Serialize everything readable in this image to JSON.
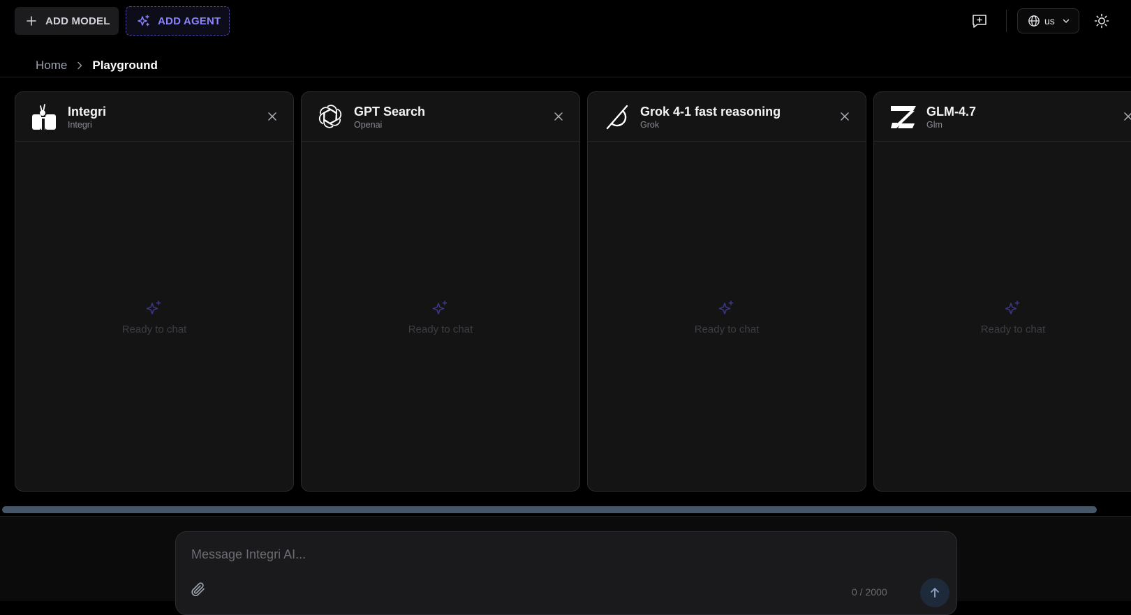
{
  "toolbar": {
    "add_model_label": "ADD MODEL",
    "add_agent_label": "ADD AGENT",
    "language": "us"
  },
  "breadcrumb": {
    "home": "Home",
    "current": "Playground"
  },
  "panels": [
    {
      "title": "Integri",
      "provider": "Integri",
      "status": "Ready to chat"
    },
    {
      "title": "GPT Search",
      "provider": "Openai",
      "status": "Ready to chat"
    },
    {
      "title": "Grok 4-1 fast reasoning",
      "provider": "Grok",
      "status": "Ready to chat"
    },
    {
      "title": "GLM-4.7",
      "provider": "Glm",
      "status": "Ready to chat"
    }
  ],
  "composer": {
    "placeholder": "Message Integri AI...",
    "value": "",
    "char_count": "0 / 2000"
  },
  "colors": {
    "accent": "#8b83ff",
    "panel_bg": "#141415",
    "scroll_thumb": "#475569"
  }
}
